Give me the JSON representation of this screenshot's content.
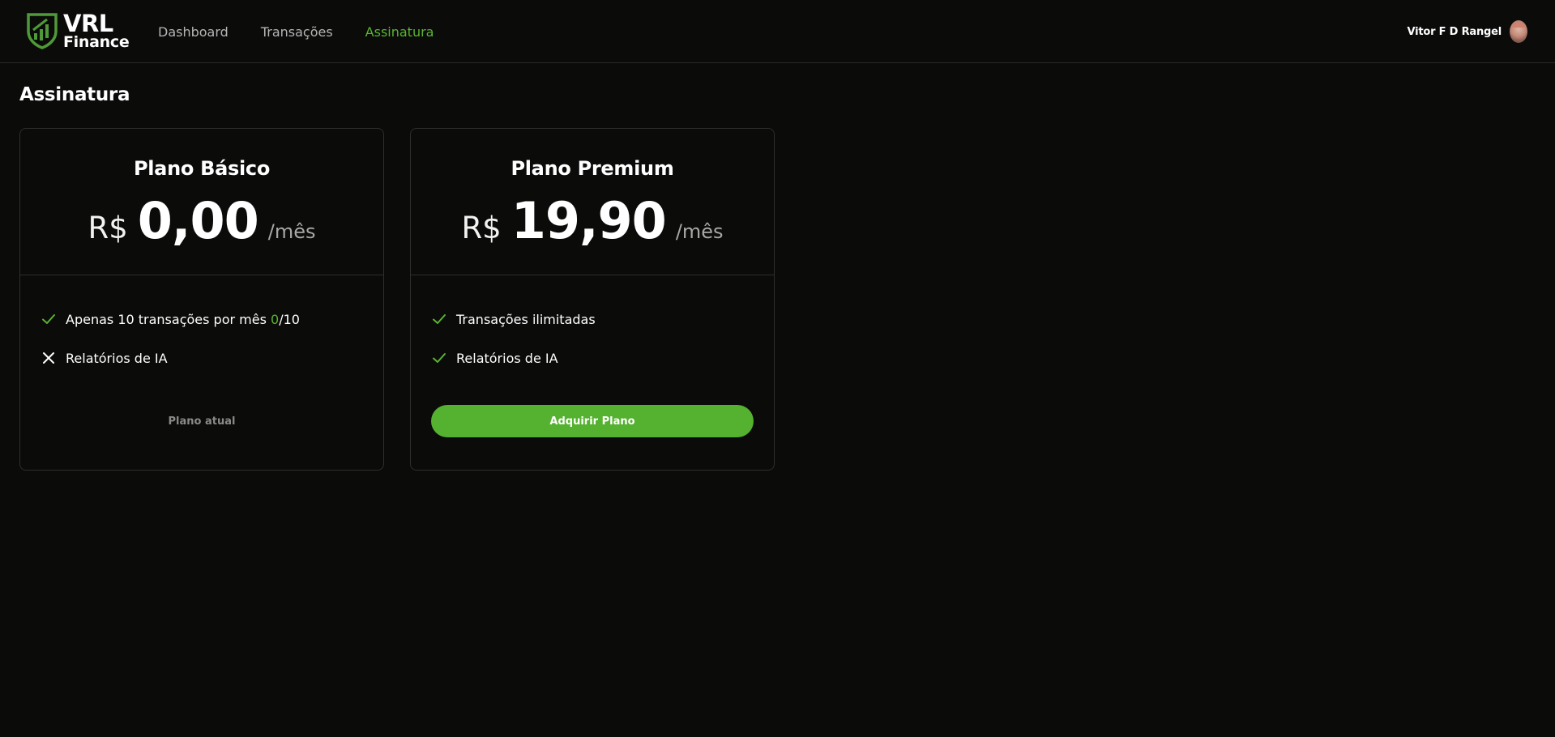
{
  "brand": {
    "line1": "VRL",
    "line2": "Finance",
    "accent": "#5ab432"
  },
  "nav": {
    "items": [
      {
        "label": "Dashboard"
      },
      {
        "label": "Transações"
      },
      {
        "label": "Assinatura"
      }
    ],
    "active": "Assinatura"
  },
  "user": {
    "name": "Vitor F D Rangel"
  },
  "page": {
    "title": "Assinatura"
  },
  "plans": [
    {
      "name": "Plano Básico",
      "currency": "R$",
      "amount": "0,00",
      "period": "/mês",
      "features": [
        {
          "icon": "check-icon",
          "text": "Apenas 10 transações por mês ",
          "usage_used": "0",
          "usage_limit": "/10"
        },
        {
          "icon": "x-icon",
          "text": "Relatórios de IA"
        }
      ],
      "action": "Plano atual"
    },
    {
      "name": "Plano Premium",
      "currency": "R$",
      "amount": "19,90",
      "period": "/mês",
      "features": [
        {
          "icon": "check-icon",
          "text": "Transações ilimitadas"
        },
        {
          "icon": "check-icon",
          "text": "Relatórios de IA"
        }
      ],
      "action": "Adquirir Plano"
    }
  ]
}
